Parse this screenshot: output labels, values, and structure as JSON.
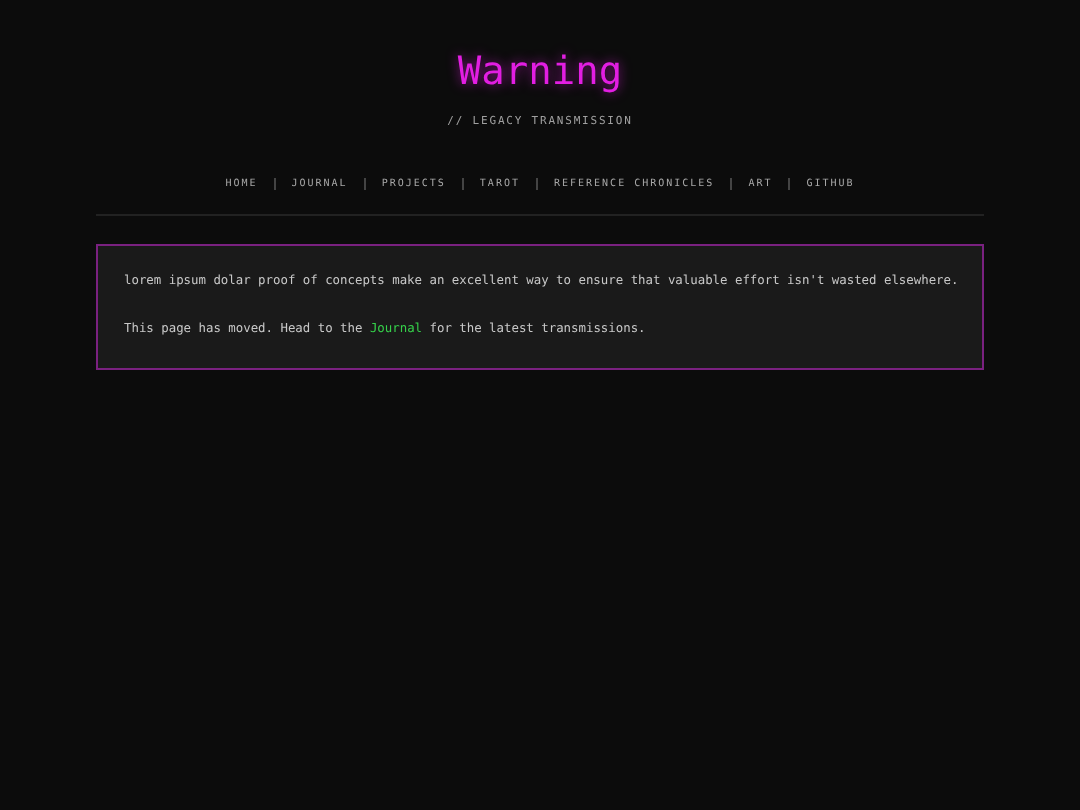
{
  "header": {
    "title": "Warning",
    "subtitle": "// LEGACY TRANSMISSION"
  },
  "nav": [
    {
      "label": "HOME"
    },
    {
      "label": "JOURNAL"
    },
    {
      "label": "PROJECTS"
    },
    {
      "label": "TAROT"
    },
    {
      "label": "REFERENCE CHRONICLES"
    },
    {
      "label": "ART"
    },
    {
      "label": "GITHUB"
    }
  ],
  "notice": {
    "paragraph": "lorem ipsum dolar proof of concepts make an excellent way to ensure that valuable effort isn't wasted elsewhere.",
    "moved": {
      "before": "This page has moved. Head to the ",
      "link": "Journal",
      "after": " for the latest transmissions."
    }
  }
}
